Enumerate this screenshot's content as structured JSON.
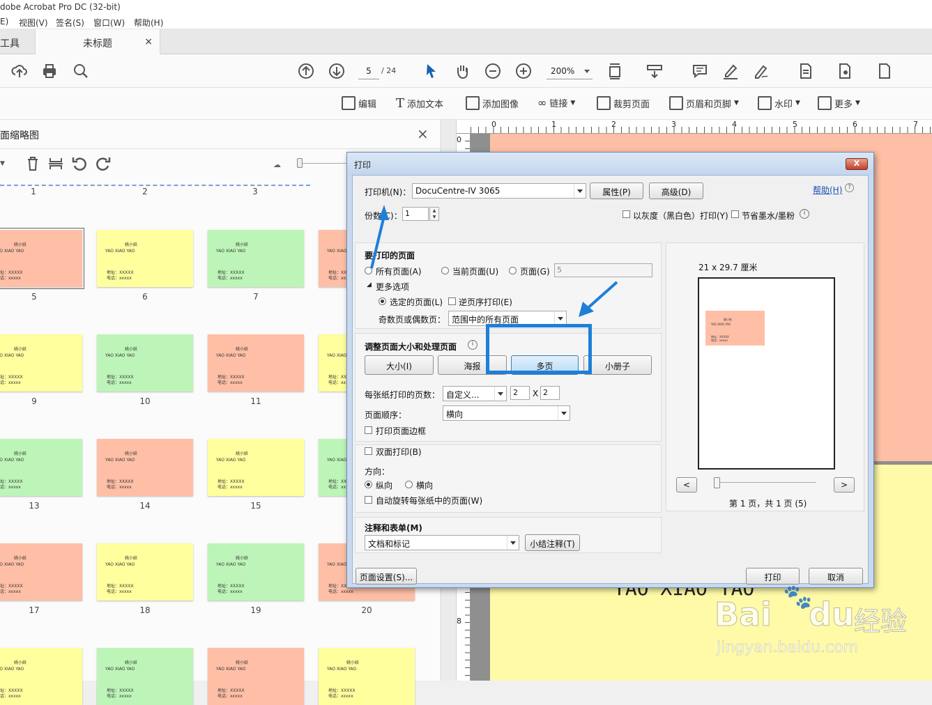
{
  "app": {
    "title": "dobe Acrobat Pro DC (32-bit)",
    "menu": [
      "E)",
      "视图(V)",
      "签名(S)",
      "窗口(W)",
      "帮助(H)"
    ],
    "tabs": {
      "tools": "工具",
      "doc": "未标题",
      "close": "×"
    }
  },
  "toolbar": {
    "page_current": "5",
    "page_total": "/ 24",
    "zoom": "200%"
  },
  "edit_toolbar": {
    "items": [
      "编辑",
      "添加文本",
      "添加图像",
      "链接",
      "裁剪页面",
      "页眉和页脚",
      "水印",
      "更多"
    ]
  },
  "left_panel": {
    "title": "面缩略图",
    "close": "×",
    "ruler_nums": [
      "1",
      "2",
      "3"
    ],
    "card": {
      "name": "姚小妖",
      "pinyin": "YAO XIAO YAO",
      "addr": "地址：XXXXX",
      "phone": "电话：xxxxx"
    },
    "page_numbers": [
      "5",
      "6",
      "7",
      "9",
      "10",
      "11",
      "13",
      "14",
      "15",
      "17",
      "18",
      "19",
      "20"
    ]
  },
  "document": {
    "ruler_top": [
      "0",
      "1",
      "2",
      "3",
      "4",
      "5",
      "6",
      "7"
    ],
    "ruler_left": [
      "0",
      "8"
    ],
    "page_text": "YAO XIAO YAO"
  },
  "print_dialog": {
    "title": "打印",
    "close": "X",
    "printer_label": "打印机(N)：",
    "printer_value": "DocuCentre-IV 3065",
    "properties_btn": "属性(P)",
    "advanced_btn": "高级(D)",
    "help_link": "帮助(H)",
    "copies_label": "份数(C)：",
    "copies_value": "1",
    "grayscale": "以灰度（黑白色）打印(Y)",
    "save_ink": "节省墨水/墨粉",
    "pages_section": "要打印的页面",
    "all_pages": "所有页面(A)",
    "current_page": "当前页面(U)",
    "pages": "页面(G)",
    "pages_value": "5",
    "more_options": "更多选项",
    "selected_pages": "选定的页面(L)",
    "reverse": "逆页序打印(E)",
    "odd_even_label": "奇数页或偶数页：",
    "odd_even_value": "范围中的所有页面",
    "sizing_section": "调整页面大小和处理页面",
    "btn_size": "大小(I)",
    "btn_poster": "海报",
    "btn_multiple": "多页",
    "btn_booklet": "小册子",
    "pages_per_sheet_label": "每张纸打印的页数：",
    "pages_per_sheet_value": "自定义...",
    "per_sheet_x": "2",
    "per_sheet_times": "X",
    "per_sheet_y": "2",
    "page_order_label": "页面顺序：",
    "page_order_value": "横向",
    "print_border": "打印页面边框",
    "duplex": "双面打印(B)",
    "orientation_label": "方向：",
    "portrait": "纵向",
    "landscape": "横向",
    "auto_rotate": "自动旋转每张纸中的页面(W)",
    "comments_section": "注释和表单(M)",
    "comments_value": "文档和标记",
    "summarize_btn": "小结注释(T)",
    "preview_size": "21 x 29.7 厘米",
    "prev_btn": "<",
    "next_btn": ">",
    "preview_status": "第 1 页，共 1 页 (5)",
    "page_setup_btn": "页面设置(S)...",
    "print_btn": "打印",
    "cancel_btn": "取消"
  },
  "watermark": {
    "logo_text": "Bai",
    "logo_text2": "du",
    "cn": "经验",
    "url": "jingyan.baidu.com"
  },
  "colors": {
    "salmon": "#ffbfa6",
    "yellow": "#ffff9e",
    "green": "#bdf5b8",
    "highlight": "#1e7fd8"
  }
}
